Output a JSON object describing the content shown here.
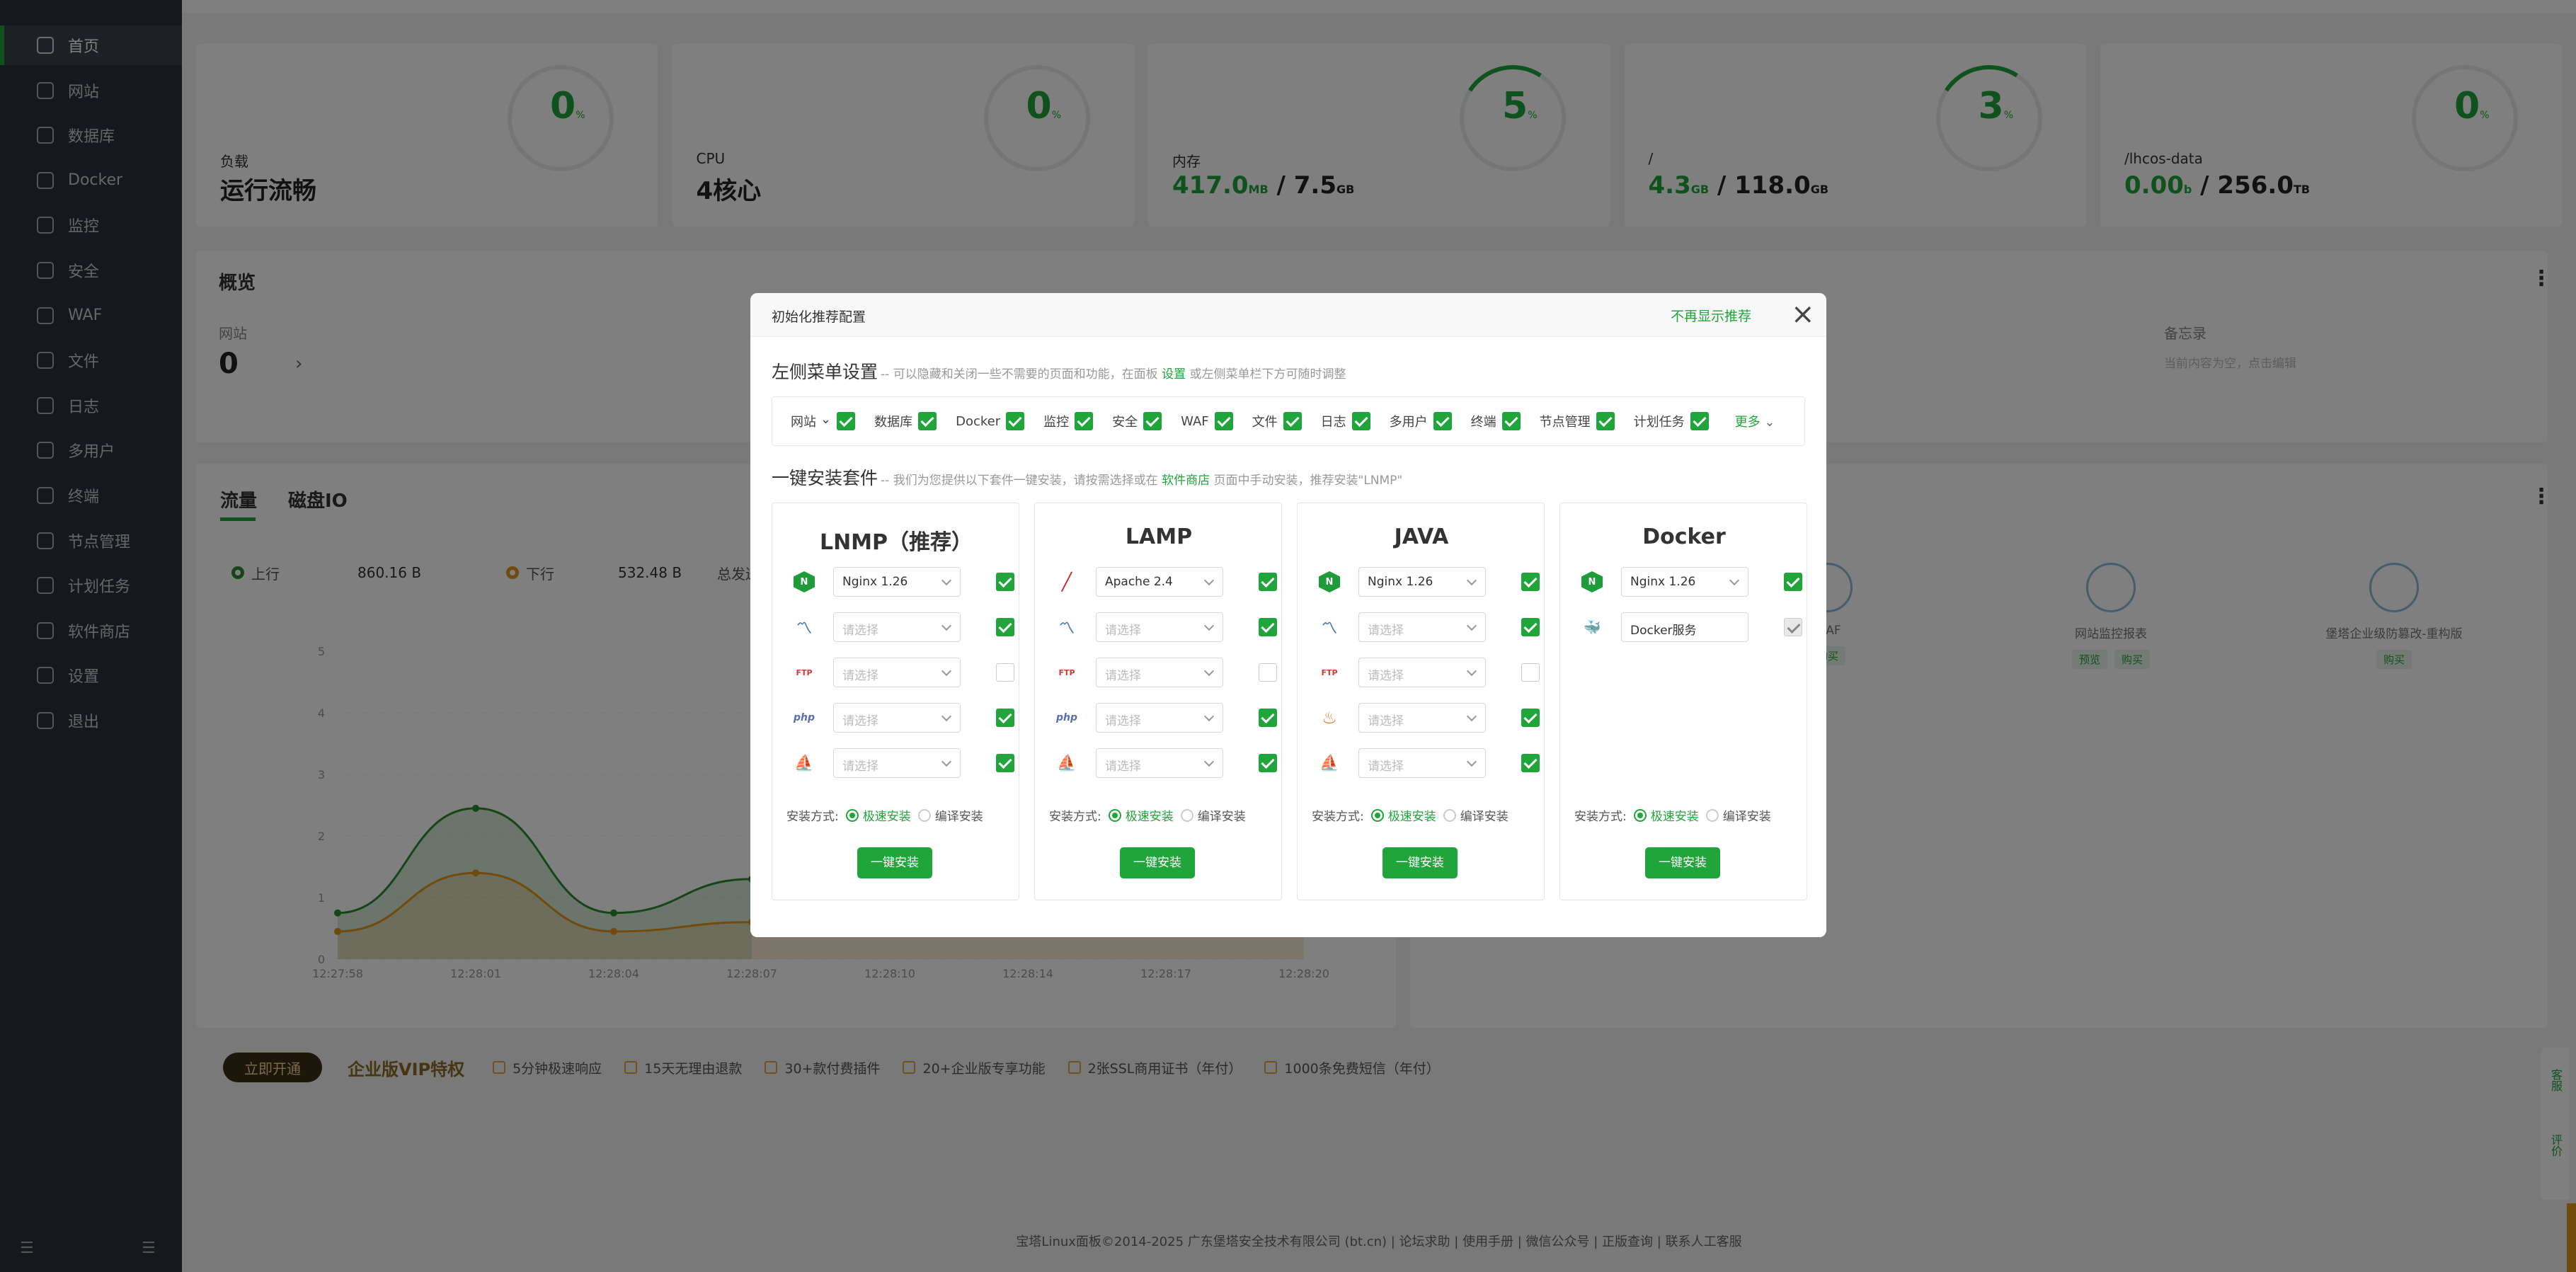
{
  "sidebar": {
    "items": [
      {
        "label": "首页",
        "active": true
      },
      {
        "label": "网站"
      },
      {
        "label": "数据库"
      },
      {
        "label": "Docker"
      },
      {
        "label": "监控"
      },
      {
        "label": "安全"
      },
      {
        "label": "WAF"
      },
      {
        "label": "文件"
      },
      {
        "label": "日志"
      },
      {
        "label": "多用户"
      },
      {
        "label": "终端"
      },
      {
        "label": "节点管理"
      },
      {
        "label": "计划任务"
      },
      {
        "label": "软件商店"
      },
      {
        "label": "设置"
      },
      {
        "label": "退出"
      }
    ],
    "bottom_left_icon": "collapse-icon",
    "bottom_right_icon": "list-icon"
  },
  "stats": [
    {
      "label": "负载",
      "value": "运行流畅",
      "ring": "0",
      "ring_unit": "%"
    },
    {
      "label": "CPU",
      "value": "4核心",
      "ring": "0",
      "ring_unit": "%"
    },
    {
      "label": "内存",
      "value_green": "417.0",
      "value_green_unit": "MB",
      "value_rest": " / 7.5",
      "value_rest_unit": "GB",
      "ring": "5",
      "ring_unit": "%"
    },
    {
      "label": "/",
      "value_green": "4.3",
      "value_green_unit": "GB",
      "value_rest": " / 118.0",
      "value_rest_unit": "GB",
      "ring": "3",
      "ring_unit": "%"
    },
    {
      "label": "/lhcos-data",
      "value_green": "0.00",
      "value_green_unit": "b",
      "value_rest": " / 256.0",
      "value_rest_unit": "TB",
      "ring": "0",
      "ring_unit": "%"
    }
  ],
  "overview": {
    "title": "概览",
    "site_label": "网站",
    "site_count": "0",
    "memo_label": "备忘录",
    "memo_hint": "当前内容为空，点击编辑"
  },
  "traffic": {
    "tab_flow": "流量",
    "tab_disk": "磁盘IO",
    "up_label": "上行",
    "up_value": "860.16 B",
    "down_label": "下行",
    "down_value": "532.48 B",
    "total_label": "总发送"
  },
  "chart_data": {
    "type": "area",
    "x": [
      "12:27:58",
      "12:28:01",
      "12:28:04",
      "12:28:07",
      "12:28:10",
      "12:28:14",
      "12:28:17",
      "12:28:20"
    ],
    "ylim": [
      0,
      5
    ],
    "yticks": [
      "0",
      "1",
      "2",
      "3",
      "4",
      "5"
    ],
    "series": [
      {
        "color": "#2e8b2e",
        "values": [
          0.75,
          2.45,
          0.75,
          1.3,
          null,
          null,
          null,
          null
        ]
      },
      {
        "color": "#e0961a",
        "values": [
          0.45,
          1.4,
          0.45,
          0.6,
          null,
          0.6,
          0.5,
          0.5
        ]
      }
    ]
  },
  "plugins": [
    {
      "name": "WAF",
      "buttons": [
        "购买"
      ]
    },
    {
      "name": "网站监控报表",
      "buttons": [
        "预览",
        "购买"
      ]
    },
    {
      "name": "堡塔企业级防篡改-重构版",
      "buttons": [
        "购买"
      ]
    }
  ],
  "vip": {
    "button": "立即开通",
    "title": "企业版VIP特权",
    "perks": [
      "5分钟极速响应",
      "15天无理由退款",
      "30+款付费插件",
      "20+企业版专享功能",
      "2张SSL商用证书（年付）",
      "1000条免费短信（年付）"
    ]
  },
  "footer": "宝塔Linux面板©2014-2025 广东堡塔安全技术有限公司 (bt.cn)  |  论坛求助  |  使用手册  |  微信公众号  |  正版查询  |  联系人工客服",
  "modal": {
    "title": "初始化推荐配置",
    "no_display": "不再显示推荐",
    "menu_title": "左侧菜单设置",
    "menu_desc": "-- 可以隐藏和关闭一些不需要的页面和功能，在面板 ",
    "menu_link": "设置",
    "menu_desc2": " 或左侧菜单栏下方可随时调整",
    "menu_items": [
      "网站",
      "数据库",
      "Docker",
      "监控",
      "安全",
      "WAF",
      "文件",
      "日志",
      "多用户",
      "终端",
      "节点管理",
      "计划任务"
    ],
    "menu_more": "更多",
    "install_title": "一键安装套件",
    "install_desc": "-- 我们为您提供以下套件一键安装，请按需选择或在 ",
    "install_link": "软件商店",
    "install_desc2": " 页面中手动安装，推荐安装\"LNMP\"",
    "mode_label": "安装方式:",
    "mode_fast": "极速安装",
    "mode_compile": "编译安装",
    "install_button": "一键安装",
    "packs": [
      {
        "title": "LNMP（推荐）",
        "rows": [
          {
            "icon": "nginx-icon",
            "value": "Nginx 1.26",
            "checked": true
          },
          {
            "icon": "mysql-icon",
            "value": "请选择",
            "checked": true
          },
          {
            "icon": "ftp-icon",
            "value": "请选择",
            "checked": false
          },
          {
            "icon": "php-icon",
            "value": "请选择",
            "checked": true
          },
          {
            "icon": "phpmyadmin-icon",
            "value": "请选择",
            "checked": true
          }
        ]
      },
      {
        "title": "LAMP",
        "rows": [
          {
            "icon": "apache-icon",
            "value": "Apache 2.4",
            "checked": true
          },
          {
            "icon": "mysql-icon",
            "value": "请选择",
            "checked": true
          },
          {
            "icon": "ftp-icon",
            "value": "请选择",
            "checked": false
          },
          {
            "icon": "php-icon",
            "value": "请选择",
            "checked": true
          },
          {
            "icon": "phpmyadmin-icon",
            "value": "请选择",
            "checked": true
          }
        ]
      },
      {
        "title": "JAVA",
        "rows": [
          {
            "icon": "nginx-icon",
            "value": "Nginx 1.26",
            "checked": true
          },
          {
            "icon": "mysql-icon",
            "value": "请选择",
            "checked": true
          },
          {
            "icon": "ftp-icon",
            "value": "请选择",
            "checked": false
          },
          {
            "icon": "java-icon",
            "value": "请选择",
            "checked": true
          },
          {
            "icon": "phpmyadmin-icon",
            "value": "请选择",
            "checked": true
          }
        ]
      },
      {
        "title": "Docker",
        "rows": [
          {
            "icon": "nginx-icon",
            "value": "Nginx 1.26",
            "checked": true
          },
          {
            "icon": "docker-icon",
            "value": "Docker服务",
            "checked": true,
            "disabled": true
          }
        ]
      }
    ]
  },
  "side_widget": {
    "service": "客服",
    "review": "评价"
  }
}
